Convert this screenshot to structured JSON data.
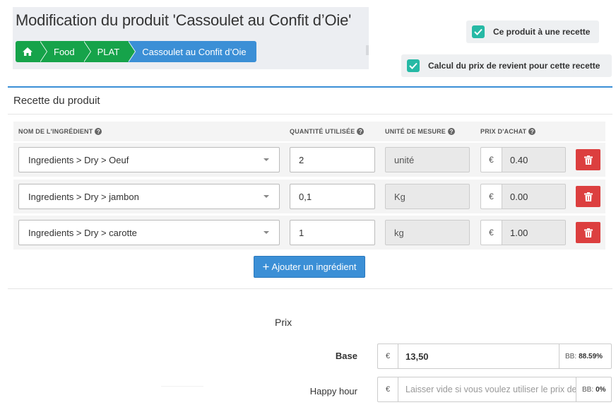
{
  "page": {
    "title": "Modification du produit 'Cassoulet au Confit d’Oie'"
  },
  "breadcrumb": {
    "home_icon": "home-icon",
    "items": [
      "Food",
      "PLAT",
      "Cassoulet au Confit d’Oie"
    ]
  },
  "checkboxes": {
    "has_recipe": "Ce produit à une recette",
    "cost_price": "Calcul du prix de revient pour cette recette"
  },
  "recipe": {
    "title": "Recette du produit",
    "headers": {
      "ingredient": "NOM DE L'INGRÉDIENT",
      "quantity": "QUANTITÉ UTILISÉE",
      "unit": "UNITÉ DE MESURE",
      "price": "PRIX D'ACHAT"
    },
    "help_glyph": "?",
    "currency": "€",
    "rows": [
      {
        "ingredient": "Ingredients > Dry > Oeuf",
        "quantity": "2",
        "unit": "unité",
        "price": "0.40"
      },
      {
        "ingredient": "Ingredients > Dry > jambon",
        "quantity": "0,1",
        "unit": "Kg",
        "price": "0.00"
      },
      {
        "ingredient": "Ingredients > Dry > carotte",
        "quantity": "1",
        "unit": "kg",
        "price": "1.00"
      }
    ],
    "add_button": "Ajouter un ingrédient",
    "add_icon": "+"
  },
  "prix": {
    "title": "Prix",
    "currency": "€",
    "base": {
      "label": "Base",
      "value": "13,50",
      "bb_label": "BB:",
      "bb_value": "88.59%"
    },
    "happy_hour": {
      "label": "Happy hour",
      "placeholder": "Laisser vide si vous voulez utiliser le prix de base",
      "bb_label": "BB:",
      "bb_value": "0%"
    }
  },
  "colors": {
    "green": "#16a34a",
    "blue": "#3b8fd6",
    "teal": "#26b9a5",
    "red": "#dc3f3f"
  }
}
